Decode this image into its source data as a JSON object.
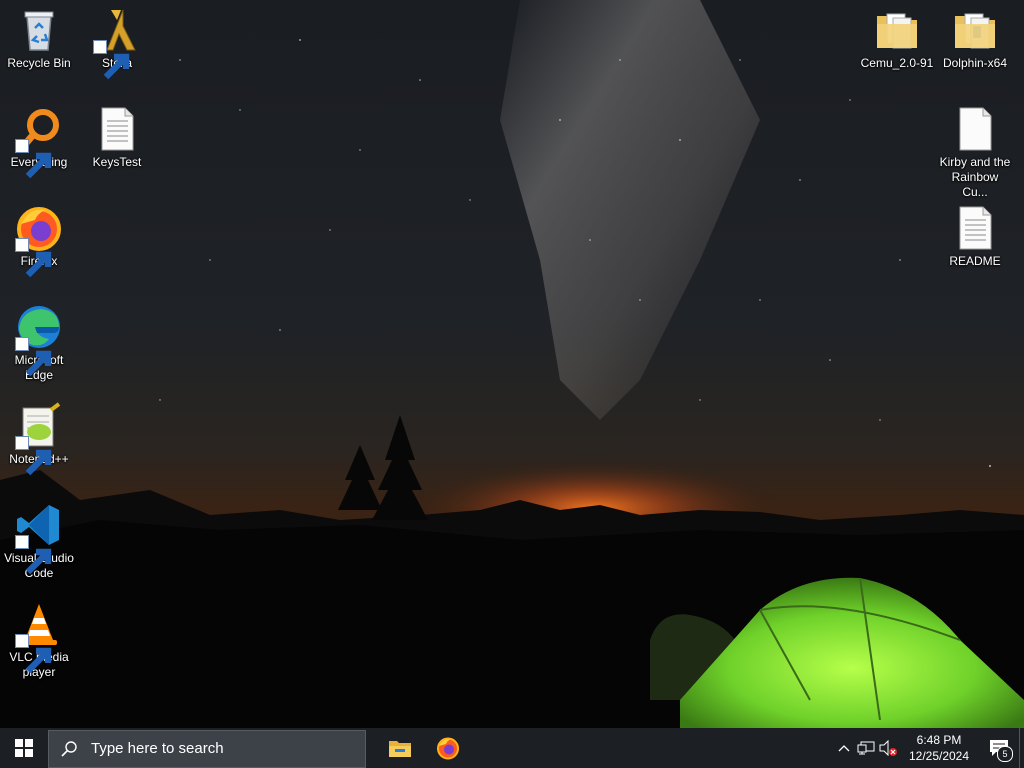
{
  "desktop": {
    "left_icons": [
      {
        "label": "Recycle Bin",
        "icon": "recycle-bin-icon"
      },
      {
        "label": "Everything",
        "icon": "everything-icon"
      },
      {
        "label": "Firefox",
        "icon": "firefox-icon"
      },
      {
        "label": "Microsoft Edge",
        "icon": "edge-icon"
      },
      {
        "label": "Notepad++",
        "icon": "notepadpp-icon"
      },
      {
        "label": "Visual Studio Code",
        "icon": "vscode-icon"
      },
      {
        "label": "VLC media player",
        "icon": "vlc-icon"
      }
    ],
    "second_column_icons": [
      {
        "label": "Stella",
        "icon": "stella-icon"
      },
      {
        "label": "KeysTest",
        "icon": "text-file-icon"
      }
    ],
    "right_icons": [
      {
        "label": "Cemu_2.0-91",
        "icon": "folder-icon"
      },
      {
        "label": "Dolphin-x64",
        "icon": "folder-icon"
      },
      {
        "label": "Kirby and the Rainbow Cu...",
        "icon": "blank-file-icon"
      },
      {
        "label": "README",
        "icon": "text-file-icon"
      }
    ]
  },
  "taskbar": {
    "search_placeholder": "Type here to search",
    "pinned_apps": [
      "file-explorer-icon",
      "firefox-icon"
    ],
    "tray": {
      "time": "6:48 PM",
      "date": "12/25/2024",
      "notification_count": "5"
    }
  },
  "colors": {
    "taskbar_bg": "#1c1f24",
    "search_bg": "#3d4249",
    "tent_green": "#7ddc2e",
    "horizon_orange": "#e0661c"
  }
}
